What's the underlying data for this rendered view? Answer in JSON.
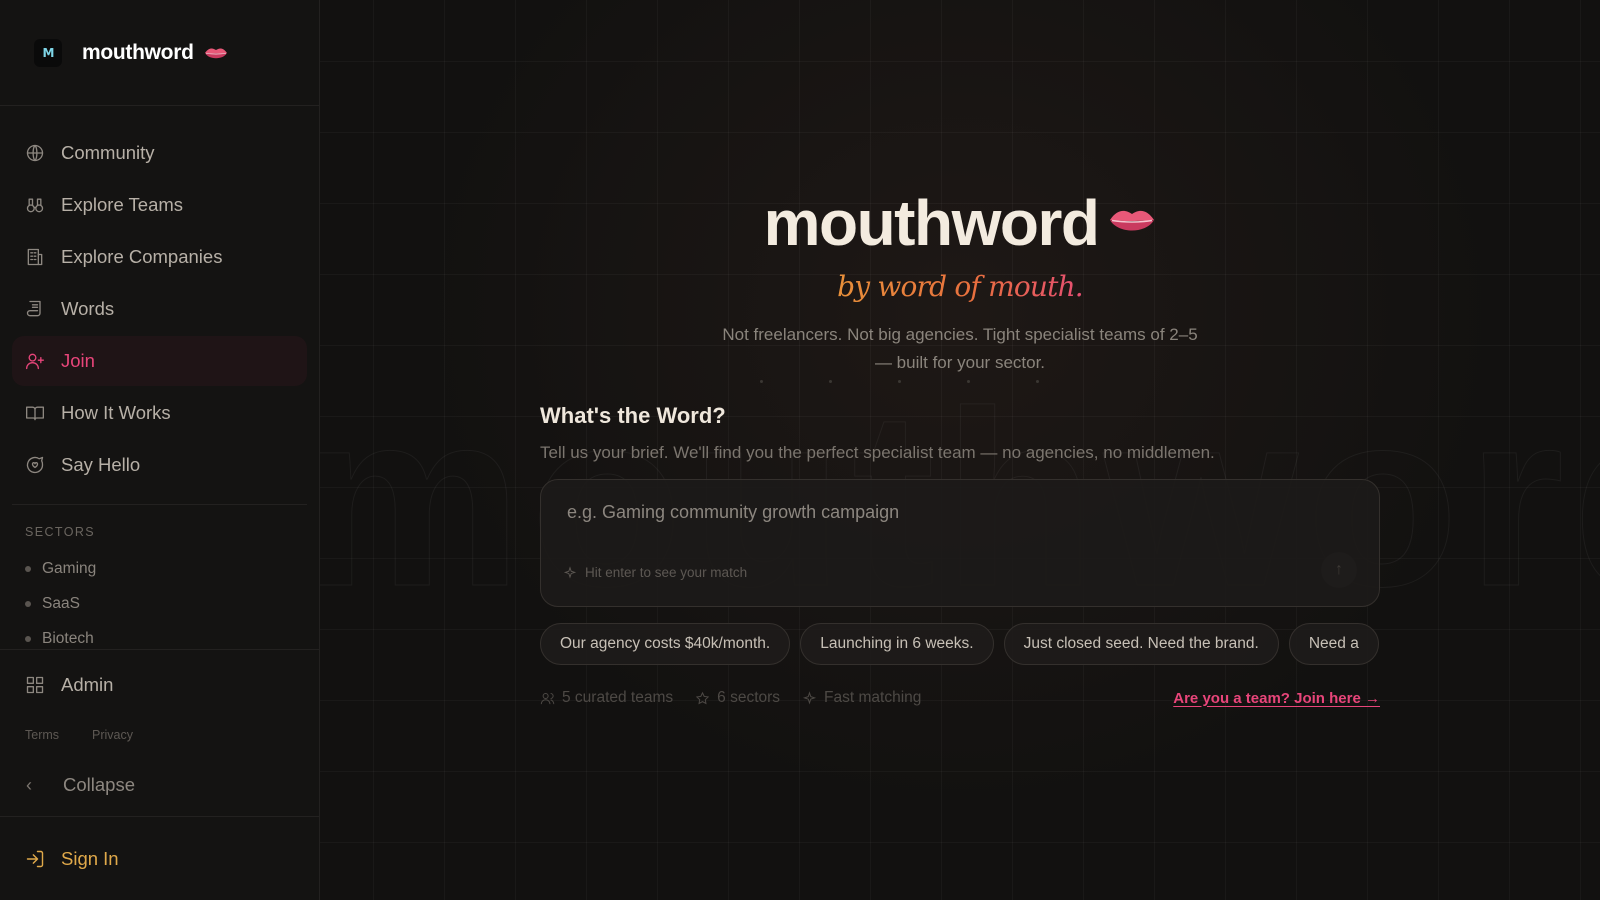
{
  "brand": {
    "logo_text": "M",
    "name": "mouthword"
  },
  "nav": {
    "items": [
      {
        "label": "Community",
        "icon": "globe-icon"
      },
      {
        "label": "Explore Teams",
        "icon": "binoculars-icon"
      },
      {
        "label": "Explore Companies",
        "icon": "building-icon"
      },
      {
        "label": "Words",
        "icon": "scroll-icon"
      },
      {
        "label": "Join",
        "icon": "user-plus-icon",
        "active": true
      },
      {
        "label": "How It Works",
        "icon": "book-open-icon"
      },
      {
        "label": "Say Hello",
        "icon": "message-heart-icon"
      }
    ]
  },
  "sectors": {
    "label": "SECTORS",
    "items": [
      "Gaming",
      "SaaS",
      "Biotech"
    ]
  },
  "admin": {
    "label": "Admin",
    "icon": "grid-icon"
  },
  "legal": {
    "terms": "Terms",
    "privacy": "Privacy"
  },
  "collapse": {
    "label": "Collapse"
  },
  "signin": {
    "label": "Sign In"
  },
  "hero": {
    "title": "mouthword",
    "tagline": "by word of mouth.",
    "subtext": "Not freelancers. Not big agencies. Tight specialist teams of 2–5 — built for your sector."
  },
  "brief": {
    "title": "What's the Word?",
    "subtitle": "Tell us your brief. We'll find you the perfect specialist team — no agencies, no middlemen.",
    "placeholder": "e.g. Gaming community growth campaign",
    "hint": "Hit enter to see your match"
  },
  "chips": [
    "Our agency costs $40k/month.",
    "Launching in 6 weeks.",
    "Just closed seed. Need the brand.",
    "Need a"
  ],
  "meta": {
    "teams": "5 curated teams",
    "sectors": "6 sectors",
    "matching": "Fast matching",
    "join_link": "Are you a team? Join here →"
  },
  "colors": {
    "accent_pink": "#e8457a",
    "accent_gold": "#e0a94a",
    "background": "#121110"
  }
}
